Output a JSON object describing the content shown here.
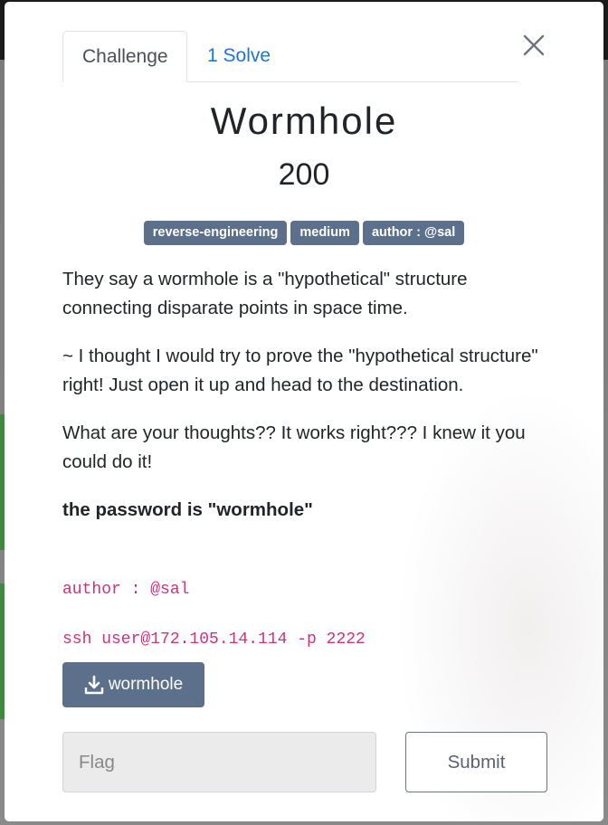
{
  "modal": {
    "tabs": [
      {
        "label": "Challenge",
        "active": true
      },
      {
        "label": "1 Solve",
        "active": false
      }
    ],
    "close_icon": "close-icon",
    "title": "Wormhole",
    "value": "200",
    "tags": [
      "reverse-engineering",
      "medium",
      "author : @sal"
    ],
    "description": [
      "They say a wormhole is a \"hypothetical\" structure connecting disparate points in space time.",
      "~ I thought I would try to prove the \"hypothetical structure\" right! Just open it up and head to the destination.",
      "What are your thoughts?? It works right??? I knew it you could do it!"
    ],
    "password_line": "the password is \"wormhole\"",
    "code_author": "author : @sal",
    "code_ssh": "ssh user@172.105.14.114 -p 2222",
    "download": {
      "label": "wormhole",
      "icon": "download-icon"
    },
    "flag_input": {
      "value": "",
      "placeholder": "Flag"
    },
    "submit_label": "Submit"
  },
  "colors": {
    "tag_bg": "#5c6f8b",
    "link": "#1e73d8",
    "code": "#d0307f"
  }
}
